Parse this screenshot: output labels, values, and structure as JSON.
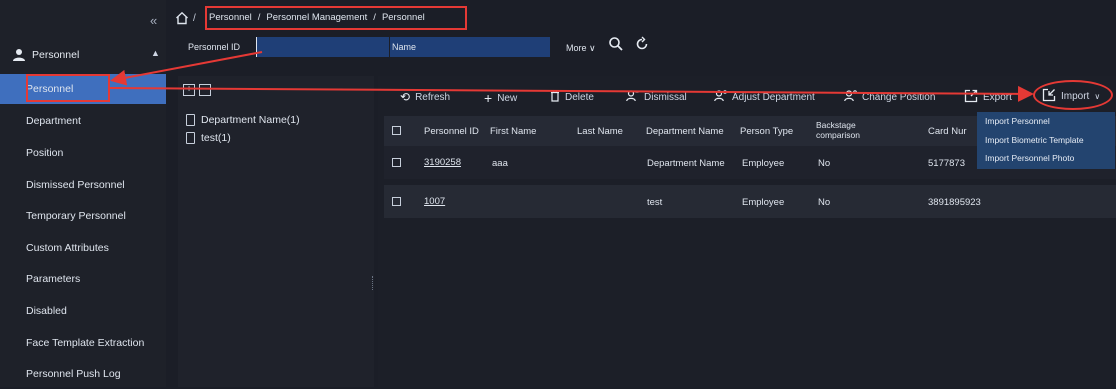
{
  "sidebar": {
    "collapse_glyph": "«",
    "group_label": "Personnel",
    "group_caret": "▲",
    "items": [
      {
        "label": "Personnel",
        "active": true
      },
      {
        "label": "Department"
      },
      {
        "label": "Position"
      },
      {
        "label": "Dismissed Personnel"
      },
      {
        "label": "Temporary Personnel"
      },
      {
        "label": "Custom Attributes"
      },
      {
        "label": "Parameters"
      },
      {
        "label": "Disabled"
      },
      {
        "label": "Face Template Extraction"
      },
      {
        "label": "Personnel Push Log"
      }
    ]
  },
  "breadcrumb": {
    "sep": "/",
    "items": [
      "Personnel",
      "Personnel Management",
      "Personnel"
    ]
  },
  "filters": {
    "personnel_id_label": "Personnel ID",
    "personnel_id_value": "",
    "name_label": "Name",
    "more_label": "More ∨"
  },
  "tree": {
    "expand_glyph": "+",
    "collapse_glyph": "−",
    "items": [
      "Department Name(1)",
      "test(1)"
    ]
  },
  "toolbar": {
    "refresh": "Refresh",
    "new": "New",
    "delete": "Delete",
    "dismissal": "Dismissal",
    "adjust_department": "Adjust Department",
    "change_position": "Change Position",
    "export": "Export",
    "import": "Import"
  },
  "table": {
    "columns": [
      "Personnel ID",
      "First Name",
      "Last Name",
      "Department Name",
      "Person Type",
      "Backstage comparison",
      "Card Nur"
    ],
    "rows": [
      {
        "id": "3190258",
        "first": "aaa",
        "last": "",
        "dept": "Department Name",
        "type": "Employee",
        "backstage": "No",
        "card": "5177873"
      },
      {
        "id": "1007",
        "first": "",
        "last": "",
        "dept": "test",
        "type": "Employee",
        "backstage": "No",
        "card": "3891895923"
      }
    ]
  },
  "import_menu": {
    "items": [
      "Import Personnel",
      "Import Biometric Template",
      "Import Personnel Photo"
    ]
  },
  "colors": {
    "accent": "#3f6fbe",
    "annotation_red": "#e53935"
  }
}
